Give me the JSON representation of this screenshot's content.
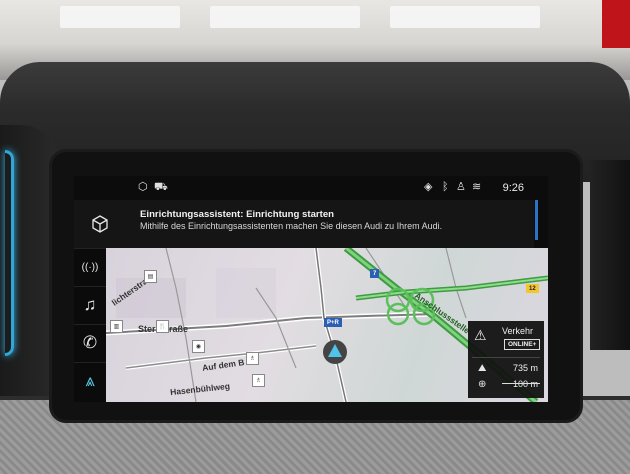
{
  "status_bar": {
    "time": "9:26",
    "left_icons": [
      "box-icon",
      "car-icon"
    ],
    "right_icons": [
      "location-warning-icon",
      "bluetooth-icon",
      "user-icon",
      "signal-icon"
    ]
  },
  "notification": {
    "icon": "box-icon",
    "title": "Einrichtungsassistent: Einrichtung starten",
    "message": "Mithilfe des Einrichtungsassistenten machen Sie diesen Audi zu Ihrem Audi."
  },
  "side_rail": {
    "items": [
      {
        "name": "radio",
        "icon": "radio-icon",
        "glyph": "((·))"
      },
      {
        "name": "media",
        "icon": "music-note-icon",
        "glyph": "♫"
      },
      {
        "name": "phone",
        "icon": "phone-icon",
        "glyph": "✆"
      },
      {
        "name": "navigation",
        "icon": "navigation-arrow-icon",
        "glyph": "⩓"
      }
    ]
  },
  "map": {
    "roads": {
      "road_1": "lichterstraße",
      "road_2": "Sternstraße",
      "road_3": "Auf dem B",
      "road_4": "Hasenbühlweg",
      "road_5": "Anschlussstelle"
    },
    "shields": {
      "shield_7": "7",
      "shield_12": "12",
      "shield_pr": "P+R"
    }
  },
  "traffic_panel": {
    "label": "Verkehr",
    "badge": "ONLINE+",
    "distance": "735 m",
    "scale": "100 m"
  },
  "colors": {
    "accent": "#2b74c5",
    "motorway": "#4caf50",
    "position_marker": "#4fc3e8"
  }
}
